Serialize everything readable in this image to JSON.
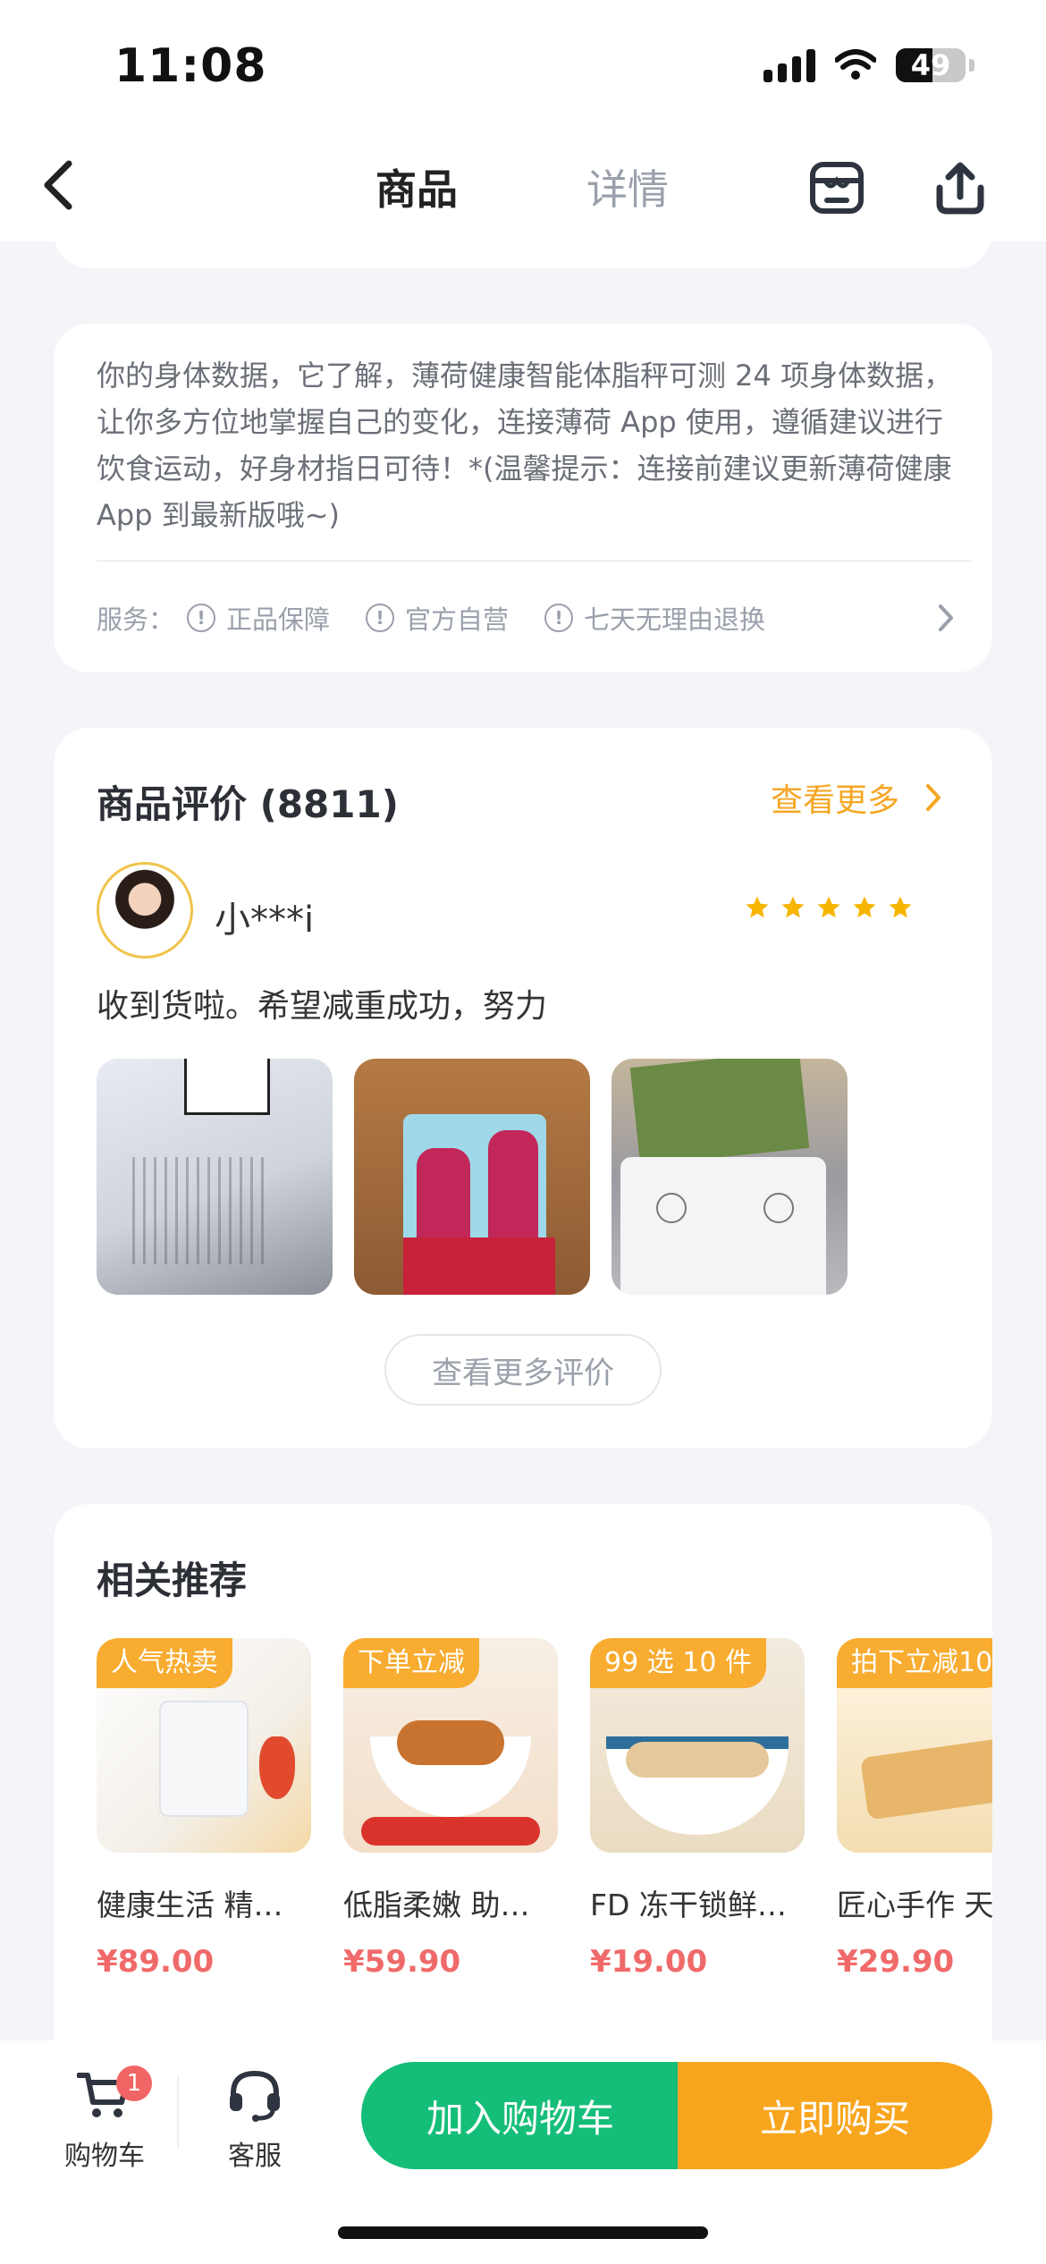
{
  "status_bar": {
    "time": "11:08",
    "battery": "49"
  },
  "nav": {
    "tabs": [
      {
        "label": "商品"
      },
      {
        "label": "详情"
      }
    ],
    "store_icon": "store-icon",
    "share_icon": "share-icon"
  },
  "description": {
    "text": "你的身体数据，它了解，薄荷健康智能体脂秤可测 24 项身体数据，让你多方位地掌握自己的变化，连接薄荷 App 使用，遵循建议进行饮食运动，好身材指日可待！*(温馨提示：连接前建议更新薄荷健康 App 到最新版哦~)",
    "service_label": "服务：",
    "services": [
      "正品保障",
      "官方自营",
      "七天无理由退换"
    ]
  },
  "review": {
    "title": "商品评价 (8811)",
    "more_label": "查看更多",
    "username": "小***i",
    "rating": 5,
    "text": "收到货啦。希望减重成功，努力",
    "more_reviews_button": "查看更多评价"
  },
  "recommend": {
    "title": "相关推荐",
    "items": [
      {
        "tag": "人气热卖",
        "name": "健康生活 精…",
        "price": "¥89.00"
      },
      {
        "tag": "下单立减",
        "name": "低脂柔嫩 助…",
        "price": "¥59.90"
      },
      {
        "tag": "99 选 10 件",
        "name": "FD 冻干锁鲜…",
        "price": "¥19.00"
      },
      {
        "tag": "拍下立减10",
        "name": "匠心手作 天",
        "price": "¥29.90"
      }
    ]
  },
  "bottom_bar": {
    "cart_label": "购物车",
    "cart_badge": "1",
    "service_label": "客服",
    "add_to_cart": "加入购物车",
    "buy_now": "立即购买"
  },
  "colors": {
    "brand_green": "#15be78",
    "accent_orange": "#f8a51e",
    "price_red": "#f06a6a"
  }
}
